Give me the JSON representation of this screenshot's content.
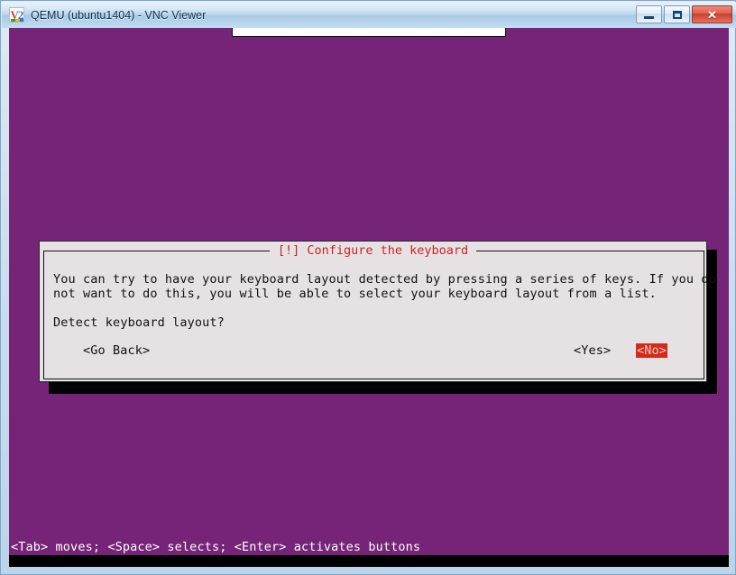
{
  "window": {
    "title": "QEMU (ubuntu1404) - VNC Viewer",
    "logo_icon": "vnc-logo-icon",
    "controls": {
      "minimize_label": "Minimize",
      "minimize_icon": "minimize-icon",
      "maximize_label": "Maximize",
      "maximize_icon": "maximize-icon",
      "close_label": "Close",
      "close_icon": "close-icon",
      "close_glyph": "✕"
    }
  },
  "colors": {
    "desktop_background": "#762478",
    "dialog_background": "#e6e2e4",
    "dialog_title_text": "#cc2222",
    "selected_button_background": "#d42a1a",
    "selected_button_text": "#f0c8c0",
    "status_text": "#ffffff",
    "shadow": "#000000"
  },
  "dialog": {
    "title": "[!] Configure the keyboard",
    "body_line_1": "You can try to have your keyboard layout detected by pressing a series of keys. If you do",
    "body_line_2": "not want to do this, you will be able to select your keyboard layout from a list.",
    "question": "Detect keyboard layout?",
    "buttons": [
      {
        "label": "<Go Back>",
        "selected": false
      },
      {
        "label": "<Yes>",
        "selected": false
      },
      {
        "label": "<No>",
        "selected": true
      }
    ]
  },
  "status_bar": {
    "text": "<Tab> moves; <Space> selects; <Enter> activates buttons"
  }
}
